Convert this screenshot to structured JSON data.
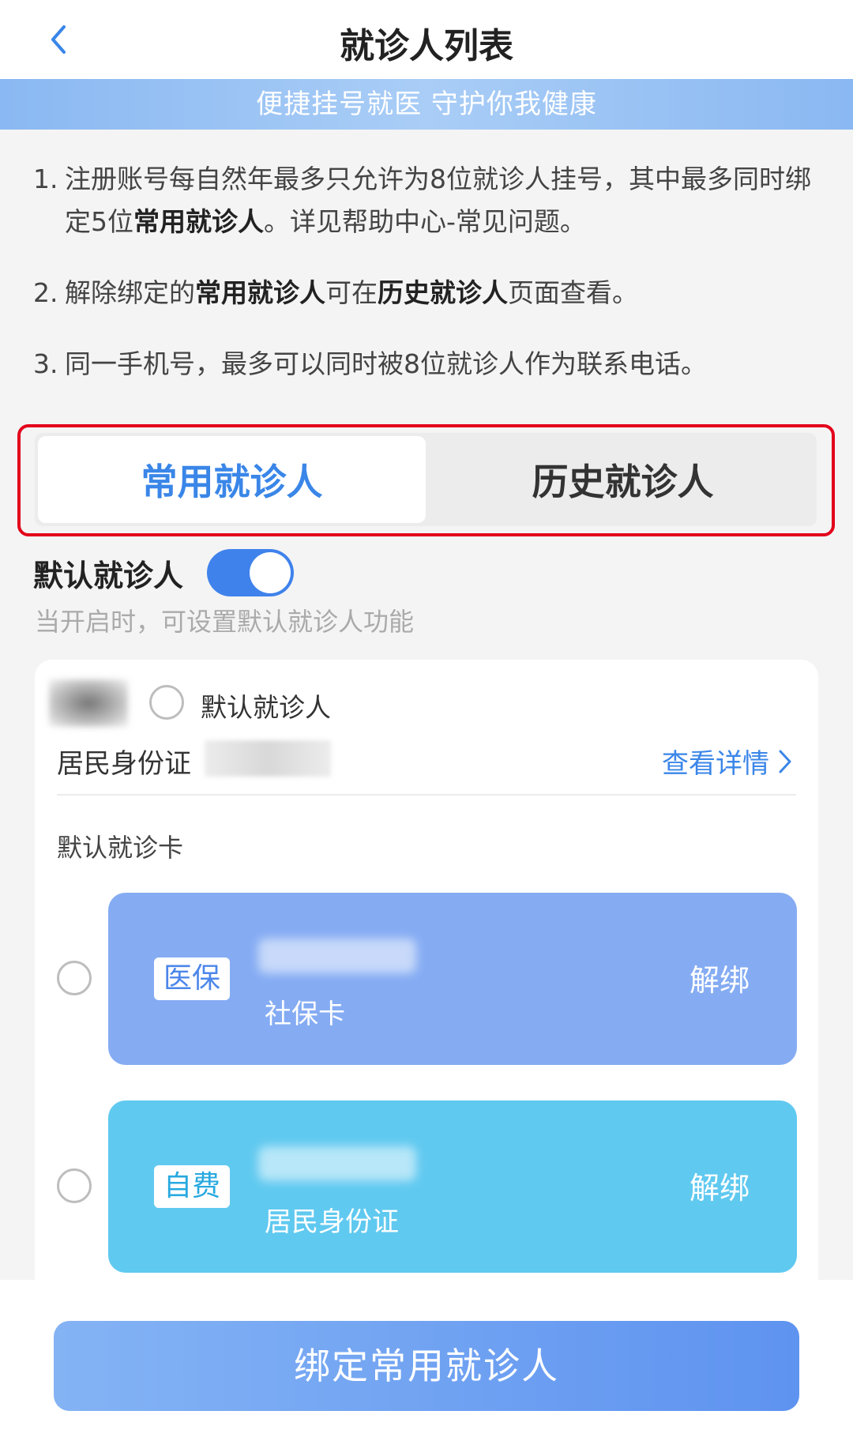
{
  "header": {
    "title": "就诊人列表",
    "back_icon": "chevron-left-icon",
    "accent_color": "#3a86e8"
  },
  "banner": {
    "text": "便捷挂号就医 守护你我健康"
  },
  "notes": [
    {
      "num": "1.",
      "parts": [
        {
          "text": "注册账号每自然年最多只允许为8位就诊人挂号，其中最多同时绑定5位",
          "bold": false
        },
        {
          "text": "常用就诊人",
          "bold": true
        },
        {
          "text": "。详见帮助中心-常见问题。",
          "bold": false
        }
      ]
    },
    {
      "num": "2.",
      "parts": [
        {
          "text": "解除绑定的",
          "bold": false
        },
        {
          "text": "常用就诊人",
          "bold": true
        },
        {
          "text": "可在",
          "bold": false
        },
        {
          "text": "历史就诊人",
          "bold": true
        },
        {
          "text": "页面查看。",
          "bold": false
        }
      ]
    },
    {
      "num": "3.",
      "parts": [
        {
          "text": "同一手机号，最多可以同时被8位就诊人作为联系电话。",
          "bold": false
        }
      ]
    }
  ],
  "tabs": {
    "active": "常用就诊人",
    "inactive": "历史就诊人"
  },
  "default_patient": {
    "label": "默认就诊人",
    "toggle_on": true,
    "hint": "当开启时，可设置默认就诊人功能"
  },
  "patient": {
    "default_label": "默认就诊人",
    "id_type": "居民身份证",
    "view_detail": "查看详情",
    "default_card_label": "默认就诊卡",
    "cards": [
      {
        "tag": "医保",
        "type": "社保卡",
        "unbind": "解绑",
        "color": "#85acf3"
      },
      {
        "tag": "自费",
        "type": "居民身份证",
        "unbind": "解绑",
        "color": "#60c9f0"
      }
    ]
  },
  "footer": {
    "bind_button": "绑定常用就诊人"
  }
}
